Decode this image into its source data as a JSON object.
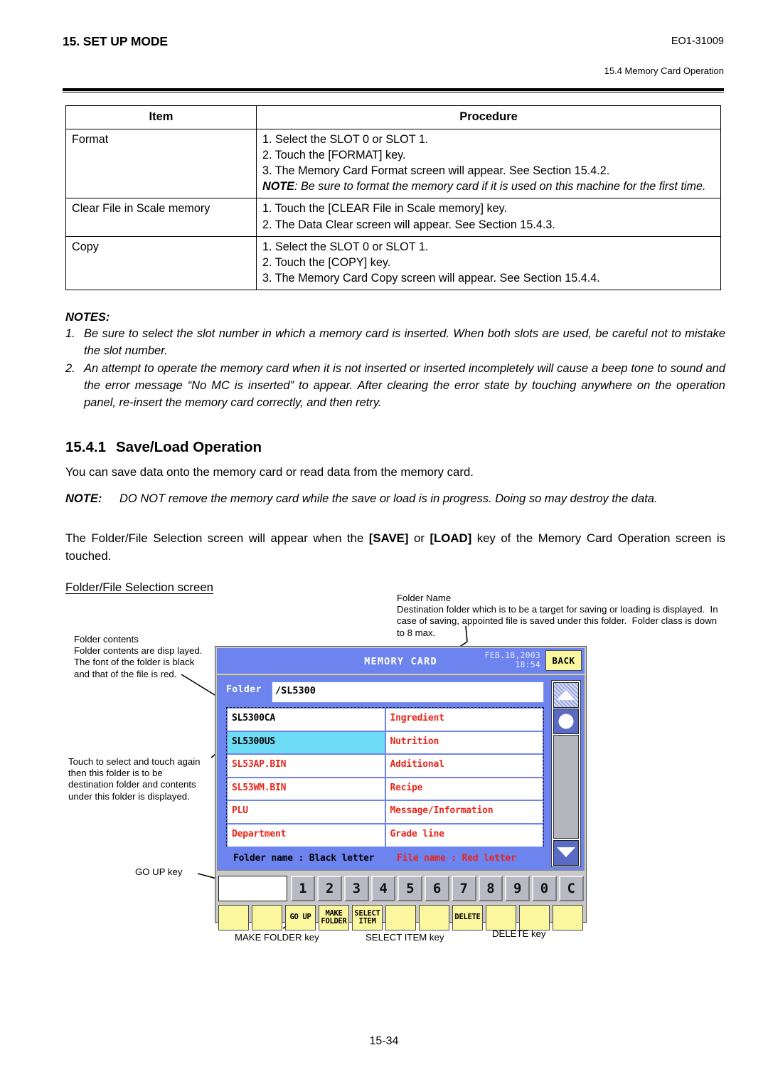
{
  "header": {
    "chapter": "15. SET UP MODE",
    "doc_code": "EO1-31009",
    "section_ref": "15.4 Memory Card Operation"
  },
  "procedure_table": {
    "columns": [
      "Item",
      "Procedure"
    ],
    "rows": [
      {
        "item": "Format",
        "steps": [
          "1. Select the SLOT 0 or SLOT 1.",
          "2. Touch the [FORMAT] key.",
          "3. The Memory Card Format screen will appear.  See Section 15.4.2."
        ],
        "note_label": "NOTE",
        "note_text": ": Be sure to format the memory card if it is used on this machine for the first time."
      },
      {
        "item": "Clear File in Scale memory",
        "steps": [
          "1. Touch the [CLEAR File in Scale memory] key.",
          "2. The Data Clear screen will appear.  See Section 15.4.3."
        ],
        "note_label": "",
        "note_text": ""
      },
      {
        "item": "Copy",
        "steps": [
          "1. Select the SLOT 0 or SLOT 1.",
          "2. Touch the [COPY] key.",
          "3. The Memory Card Copy screen will appear.  See Section 15.4.4."
        ],
        "note_label": "",
        "note_text": ""
      }
    ]
  },
  "notes": {
    "title": "NOTES:",
    "items": [
      {
        "num": "1.",
        "text": "Be sure to select the slot number in which a memory card is inserted.  When both slots are used, be careful not to mistake the slot number."
      },
      {
        "num": "2.",
        "text": "An attempt to operate the memory card when it is not inserted or inserted incompletely will cause a beep tone to sound and the error message “No MC is inserted” to appear.  After clearing the error state by touching anywhere on the operation panel, re-insert the memory card correctly, and then retry."
      }
    ]
  },
  "section": {
    "number": "15.4.1",
    "title": "Save/Load Operation",
    "intro": "You can save data onto the memory card or read data from the memory card.",
    "note_label": "NOTE:",
    "note_text": "DO NOT remove the memory card while the save or load is in progress.  Doing so may destroy the data.",
    "paragraph": "The Folder/File Selection screen will appear when the [SAVE] or [LOAD] key of the Memory Card Operation screen is touched.",
    "subheading": "Folder/File Selection screen"
  },
  "annotations": {
    "folder_name": "Folder Name\nDestination folder which is to be a target for saving or loading is displayed.  In case of saving, appointed file is saved under this folder.  Folder class is down to 8 max.",
    "folder_contents": "Folder contents\nFolder contents are disp layed.  The font of the folder is black and that of the file is red.",
    "touch_select": "Touch to select and touch again then this folder is to be destination folder and contents under this folder is displayed.",
    "go_up_key": "GO UP key",
    "make_folder_key": "MAKE FOLDER key",
    "select_item_key": "SELECT ITEM key",
    "delete_key": "DELETE key"
  },
  "lcd": {
    "title": "MEMORY CARD",
    "date": "FEB.18,2003",
    "time": "18:54",
    "back_label": "BACK",
    "folder_label": "Folder",
    "folder_path": "/SL5300",
    "entries": [
      {
        "left": "SL5300CA",
        "left_type": "black",
        "left_selected": false,
        "right": "Ingredient",
        "right_type": "red"
      },
      {
        "left": "SL5300US",
        "left_type": "black",
        "left_selected": true,
        "right": "Nutrition",
        "right_type": "red"
      },
      {
        "left": "SL53AP.BIN",
        "left_type": "red",
        "left_selected": false,
        "right": "Additional",
        "right_type": "red"
      },
      {
        "left": "SL53WM.BIN",
        "left_type": "red",
        "left_selected": false,
        "right": "Recipe",
        "right_type": "red"
      },
      {
        "left": "PLU",
        "left_type": "red",
        "left_selected": false,
        "right": "Message/Information",
        "right_type": "red"
      },
      {
        "left": "Department",
        "left_type": "red",
        "left_selected": false,
        "right": "Grade line",
        "right_type": "red"
      }
    ],
    "legend_folder": "Folder name : Black letter",
    "legend_file": "File name : Red letter",
    "num_keys": [
      "1",
      "2",
      "3",
      "4",
      "5",
      "6",
      "7",
      "8",
      "9",
      "0",
      "C"
    ],
    "function_keys": [
      "",
      "",
      "GO UP",
      "MAKE\nFOLDER",
      "SELECT\nITEM",
      "",
      "",
      "DELETE",
      "",
      "",
      ""
    ],
    "colors": {
      "screen_blue": "#6d84ef",
      "key_yellow": "#fbf79f",
      "selected_cyan": "#6fdcf5",
      "file_red": "#e8261c",
      "num_key_gray": "#b9b9c4"
    }
  },
  "footer": {
    "page_number": "15-34"
  }
}
